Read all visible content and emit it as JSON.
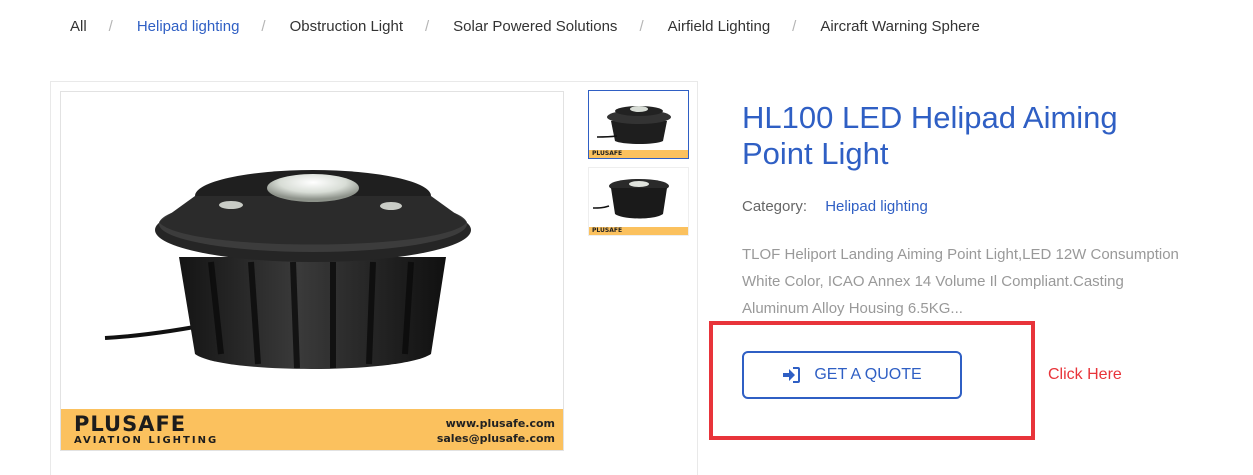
{
  "breadcrumb": {
    "items": [
      {
        "label": "All"
      },
      {
        "label": "Helipad lighting"
      },
      {
        "label": "Obstruction Light"
      },
      {
        "label": "Solar Powered Solutions"
      },
      {
        "label": "Airfield Lighting"
      },
      {
        "label": "Aircraft Warning Sphere"
      }
    ],
    "separator": "/"
  },
  "gallery": {
    "brand_name": "PLUSAFE",
    "brand_sub": "AVIATION LIGHTING",
    "website": "www.plusafe.com",
    "email": "sales@plusafe.com",
    "thumb_brand": "PLUSAFE",
    "main_image": "helipad-aiming-point-light-photo",
    "selected_thumbnail": 1
  },
  "product": {
    "title": "HL100 LED Helipad Aiming Point Light",
    "category_label": "Category:",
    "category_value": "Helipad lighting",
    "description": "TLOF Heliport Landing Aiming Point Light,LED 12W Consumption White Color, ICAO Annex 14 Volume Il Compliant.Casting Aluminum Alloy Housing 6.5KG..."
  },
  "cta": {
    "button_label": "GET A QUOTE",
    "button_icon": "sign-in-icon",
    "annotation": "Click Here"
  },
  "colors": {
    "accent": "#2f5fc4",
    "highlight": "#e8343a",
    "banner": "#fbc15e"
  }
}
